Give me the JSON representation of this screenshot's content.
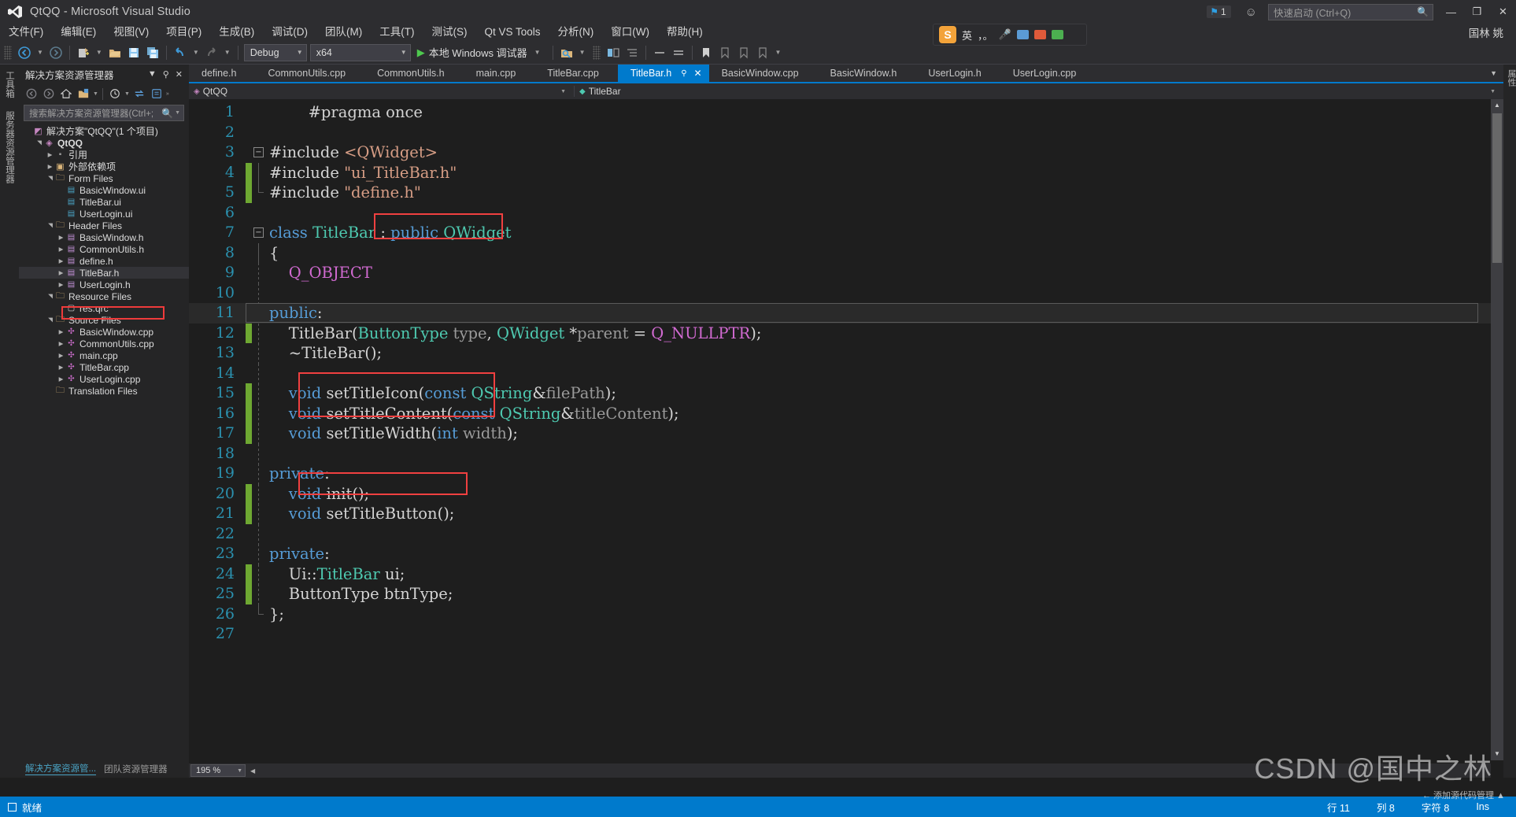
{
  "window": {
    "title": "QtQQ - Microsoft Visual Studio",
    "logo_icon": "visual-studio-logo-icon",
    "notification_count": "1",
    "notification_icon": "flag-icon",
    "feedback_icon": "feedback-smiley-icon",
    "quick_launch_placeholder": "快速启动 (Ctrl+Q)",
    "quick_launch_icon": "search-icon",
    "minimize": "—",
    "maximize": "❐",
    "close": "✕",
    "user_name": "国林 姚"
  },
  "menu": {
    "items": [
      {
        "label": "文件(F)"
      },
      {
        "label": "编辑(E)"
      },
      {
        "label": "视图(V)"
      },
      {
        "label": "项目(P)"
      },
      {
        "label": "生成(B)"
      },
      {
        "label": "调试(D)"
      },
      {
        "label": "团队(M)"
      },
      {
        "label": "工具(T)"
      },
      {
        "label": "测试(S)"
      },
      {
        "label": "Qt VS Tools"
      },
      {
        "label": "分析(N)"
      },
      {
        "label": "窗口(W)"
      },
      {
        "label": "帮助(H)"
      }
    ]
  },
  "toolbar": {
    "nav_back_icon": "arrow-back-icon",
    "nav_forward_icon": "arrow-forward-icon",
    "new_project_icon": "new-project-icon",
    "open_file_icon": "open-file-icon",
    "save_icon": "save-icon",
    "save_all_icon": "save-all-icon",
    "undo_icon": "undo-icon",
    "redo_icon": "redo-icon",
    "config": "Debug",
    "platform": "x64",
    "run_label": "本地 Windows 调试器",
    "run_icon": "play-triangle-icon",
    "find_icon": "find-in-files-icon",
    "compare_icon": "compare-icon",
    "step_icon": "step-icon",
    "indent_icon": "indent-icon",
    "comment_icon": "comment-icon",
    "uncomment_icon": "uncomment-icon",
    "bookmark_icon": "bookmark-icon"
  },
  "ime": {
    "skype_badge": "S",
    "lang": "英",
    "punct": "，。",
    "mic_icon": "microphone-icon",
    "keyboard_icon": "keyboard-icon",
    "tools_icon": "ime-tools-icon",
    "apps_icon": "ime-apps-icon"
  },
  "left_rail": {
    "tabs": [
      {
        "label": "工具箱"
      },
      {
        "label": "服务器资源管理器"
      }
    ]
  },
  "right_rail": {
    "tabs": [
      {
        "label": "属性"
      }
    ]
  },
  "solution_explorer": {
    "title": "解决方案资源管理器",
    "dropdown_icon": "chevron-down-icon",
    "pin_icon": "pin-icon",
    "close_icon": "close-icon",
    "toolbar_icons": [
      "back-icon",
      "forward-icon",
      "home-icon",
      "show-all-files-icon",
      "chevron-down-icon",
      "pending-changes-icon",
      "chevron-down-icon",
      "sync-icon",
      "refresh-icon",
      "collapse-all-icon",
      "properties-icon"
    ],
    "search_placeholder": "搜索解决方案资源管理器(Ctrl+;",
    "search_icon": "search-icon",
    "search_caret_icon": "chevron-down-icon",
    "tree": [
      {
        "label": "解决方案\"QtQQ\"(1 个项目)",
        "depth": 0,
        "expander": "",
        "icon": "solution-icon",
        "bold": false,
        "selected": false
      },
      {
        "label": "QtQQ",
        "depth": 1,
        "expander": "▲",
        "icon": "project-icon",
        "bold": true,
        "selected": false
      },
      {
        "label": "引用",
        "depth": 2,
        "expander": "▶",
        "icon": "references-icon",
        "bold": false,
        "selected": false
      },
      {
        "label": "外部依赖项",
        "depth": 2,
        "expander": "▶",
        "icon": "external-deps-icon",
        "bold": false,
        "selected": false
      },
      {
        "label": "Form Files",
        "depth": 2,
        "expander": "▲",
        "icon": "filter-folder-icon",
        "bold": false,
        "selected": false
      },
      {
        "label": "BasicWindow.ui",
        "depth": 3,
        "expander": "",
        "icon": "ui-file-icon",
        "bold": false,
        "selected": false
      },
      {
        "label": "TitleBar.ui",
        "depth": 3,
        "expander": "",
        "icon": "ui-file-icon",
        "bold": false,
        "selected": false
      },
      {
        "label": "UserLogin.ui",
        "depth": 3,
        "expander": "",
        "icon": "ui-file-icon",
        "bold": false,
        "selected": false
      },
      {
        "label": "Header Files",
        "depth": 2,
        "expander": "▲",
        "icon": "filter-folder-icon",
        "bold": false,
        "selected": false
      },
      {
        "label": "BasicWindow.h",
        "depth": 3,
        "expander": "▶",
        "icon": "header-file-icon",
        "bold": false,
        "selected": false
      },
      {
        "label": "CommonUtils.h",
        "depth": 3,
        "expander": "▶",
        "icon": "header-file-icon",
        "bold": false,
        "selected": false
      },
      {
        "label": "define.h",
        "depth": 3,
        "expander": "▶",
        "icon": "header-file-icon",
        "bold": false,
        "selected": false
      },
      {
        "label": "TitleBar.h",
        "depth": 3,
        "expander": "▶",
        "icon": "header-file-icon",
        "bold": false,
        "selected": true
      },
      {
        "label": "UserLogin.h",
        "depth": 3,
        "expander": "▶",
        "icon": "header-file-icon",
        "bold": false,
        "selected": false
      },
      {
        "label": "Resource Files",
        "depth": 2,
        "expander": "▲",
        "icon": "filter-folder-icon",
        "bold": false,
        "selected": false
      },
      {
        "label": "res.qrc",
        "depth": 3,
        "expander": "",
        "icon": "qrc-file-icon",
        "bold": false,
        "selected": false
      },
      {
        "label": "Source Files",
        "depth": 2,
        "expander": "▲",
        "icon": "filter-folder-icon",
        "bold": false,
        "selected": false
      },
      {
        "label": "BasicWindow.cpp",
        "depth": 3,
        "expander": "▶",
        "icon": "cpp-file-icon",
        "bold": false,
        "selected": false
      },
      {
        "label": "CommonUtils.cpp",
        "depth": 3,
        "expander": "▶",
        "icon": "cpp-file-icon",
        "bold": false,
        "selected": false
      },
      {
        "label": "main.cpp",
        "depth": 3,
        "expander": "▶",
        "icon": "cpp-file-icon",
        "bold": false,
        "selected": false
      },
      {
        "label": "TitleBar.cpp",
        "depth": 3,
        "expander": "▶",
        "icon": "cpp-file-icon",
        "bold": false,
        "selected": false
      },
      {
        "label": "UserLogin.cpp",
        "depth": 3,
        "expander": "▶",
        "icon": "cpp-file-icon",
        "bold": false,
        "selected": false
      },
      {
        "label": "Translation Files",
        "depth": 2,
        "expander": "",
        "icon": "filter-folder-icon",
        "bold": false,
        "selected": false
      }
    ],
    "bottom_tabs": [
      {
        "label": "解决方案资源管...",
        "active": true
      },
      {
        "label": "团队资源管理器",
        "active": false
      }
    ]
  },
  "editor": {
    "tabs": [
      {
        "label": "define.h",
        "active": false
      },
      {
        "label": "CommonUtils.cpp",
        "active": false
      },
      {
        "label": "CommonUtils.h",
        "active": false
      },
      {
        "label": "main.cpp",
        "active": false
      },
      {
        "label": "TitleBar.cpp",
        "active": false
      },
      {
        "label": "TitleBar.h",
        "active": true
      },
      {
        "label": "BasicWindow.cpp",
        "active": false
      },
      {
        "label": "BasicWindow.h",
        "active": false
      },
      {
        "label": "UserLogin.h",
        "active": false
      },
      {
        "label": "UserLogin.cpp",
        "active": false
      }
    ],
    "active_tab_pin_icon": "pin-icon",
    "active_tab_close_icon": "close-icon",
    "tab_overflow_icon": "chevron-down-icon",
    "nav_project": "QtQQ",
    "nav_project_icon": "project-icon",
    "nav_member": "TitleBar",
    "nav_member_icon": "class-icon",
    "nav_caret_icon": "chevron-down-icon",
    "zoom": "195 %",
    "zoom_caret_icon": "chevron-down-icon",
    "lines": [
      {
        "n": "1",
        "changed": false,
        "indent": 0,
        "tokens": [
          {
            "t": "        ",
            "c": "pl"
          },
          {
            "t": "#pragma once",
            "c": "pl"
          }
        ]
      },
      {
        "n": "2",
        "changed": false,
        "indent": 0,
        "tokens": []
      },
      {
        "n": "3",
        "changed": false,
        "indent": 0,
        "fold": "minus",
        "tokens": [
          {
            "t": "#include ",
            "c": "pl"
          },
          {
            "t": "<QWidget>",
            "c": "s"
          }
        ]
      },
      {
        "n": "4",
        "changed": true,
        "indent": 0,
        "bar": "line",
        "tokens": [
          {
            "t": "#include ",
            "c": "pl"
          },
          {
            "t": "\"ui_TitleBar.h\"",
            "c": "s"
          }
        ]
      },
      {
        "n": "5",
        "changed": true,
        "indent": 0,
        "bar": "corner",
        "tokens": [
          {
            "t": "#include ",
            "c": "pl"
          },
          {
            "t": "\"define.h\"",
            "c": "s"
          }
        ]
      },
      {
        "n": "6",
        "changed": false,
        "indent": 0,
        "tokens": []
      },
      {
        "n": "7",
        "changed": false,
        "indent": 0,
        "fold": "minus",
        "tokens": [
          {
            "t": "class ",
            "c": "k"
          },
          {
            "t": "TitleBar",
            "c": "t"
          },
          {
            "t": " : ",
            "c": "pl"
          },
          {
            "t": "public ",
            "c": "k"
          },
          {
            "t": "QWidget",
            "c": "t"
          }
        ]
      },
      {
        "n": "8",
        "changed": false,
        "indent": 0,
        "bar": "line",
        "tokens": [
          {
            "t": "{",
            "c": "pl"
          }
        ]
      },
      {
        "n": "9",
        "changed": false,
        "indent": 0,
        "bar": "dash",
        "tokens": [
          {
            "t": "    ",
            "c": "pl"
          },
          {
            "t": "Q_OBJECT",
            "c": "m"
          }
        ]
      },
      {
        "n": "10",
        "changed": false,
        "indent": 0,
        "bar": "dash",
        "tokens": []
      },
      {
        "n": "11",
        "changed": false,
        "indent": 0,
        "highlight": true,
        "tokens": [
          {
            "t": "public",
            "c": "k"
          },
          {
            "t": ":",
            "c": "pl"
          }
        ]
      },
      {
        "n": "12",
        "changed": true,
        "indent": 0,
        "bar": "dash",
        "tokens": [
          {
            "t": "    ",
            "c": "pl"
          },
          {
            "t": "TitleBar",
            "c": "pl"
          },
          {
            "t": "(",
            "c": "pl"
          },
          {
            "t": "ButtonType",
            "c": "t"
          },
          {
            "t": " ",
            "c": "pl"
          },
          {
            "t": "type",
            "c": "pa"
          },
          {
            "t": ", ",
            "c": "pl"
          },
          {
            "t": "QWidget",
            "c": "t"
          },
          {
            "t": " *",
            "c": "pl"
          },
          {
            "t": "parent",
            "c": "pa"
          },
          {
            "t": " = ",
            "c": "pl"
          },
          {
            "t": "Q_NULLPTR",
            "c": "m"
          },
          {
            "t": ");",
            "c": "pl"
          }
        ]
      },
      {
        "n": "13",
        "changed": false,
        "indent": 0,
        "bar": "dash",
        "tokens": [
          {
            "t": "    ~TitleBar();",
            "c": "pl"
          }
        ]
      },
      {
        "n": "14",
        "changed": false,
        "indent": 0,
        "bar": "dash",
        "tokens": []
      },
      {
        "n": "15",
        "changed": true,
        "indent": 0,
        "bar": "dash",
        "tokens": [
          {
            "t": "    ",
            "c": "pl"
          },
          {
            "t": "void ",
            "c": "k"
          },
          {
            "t": "setTitleIcon",
            "c": "pl"
          },
          {
            "t": "(",
            "c": "pl"
          },
          {
            "t": "const ",
            "c": "k"
          },
          {
            "t": "QString",
            "c": "t"
          },
          {
            "t": "&",
            "c": "pl"
          },
          {
            "t": "filePath",
            "c": "pa"
          },
          {
            "t": ");",
            "c": "pl"
          }
        ]
      },
      {
        "n": "16",
        "changed": true,
        "indent": 0,
        "bar": "dash",
        "tokens": [
          {
            "t": "    ",
            "c": "pl"
          },
          {
            "t": "void ",
            "c": "k"
          },
          {
            "t": "setTitleContent",
            "c": "pl"
          },
          {
            "t": "(",
            "c": "pl"
          },
          {
            "t": "const ",
            "c": "k"
          },
          {
            "t": "QString",
            "c": "t"
          },
          {
            "t": "&",
            "c": "pl"
          },
          {
            "t": "titleContent",
            "c": "pa"
          },
          {
            "t": ");",
            "c": "pl"
          }
        ]
      },
      {
        "n": "17",
        "changed": true,
        "indent": 0,
        "bar": "dash",
        "tokens": [
          {
            "t": "    ",
            "c": "pl"
          },
          {
            "t": "void ",
            "c": "k"
          },
          {
            "t": "setTitleWidth",
            "c": "pl"
          },
          {
            "t": "(",
            "c": "pl"
          },
          {
            "t": "int ",
            "c": "k"
          },
          {
            "t": "width",
            "c": "pa"
          },
          {
            "t": ");",
            "c": "pl"
          }
        ]
      },
      {
        "n": "18",
        "changed": false,
        "indent": 0,
        "bar": "dash",
        "tokens": []
      },
      {
        "n": "19",
        "changed": false,
        "indent": 0,
        "bar": "dash",
        "tokens": [
          {
            "t": "private",
            "c": "k"
          },
          {
            "t": ":",
            "c": "pl"
          }
        ]
      },
      {
        "n": "20",
        "changed": true,
        "indent": 0,
        "bar": "dash",
        "tokens": [
          {
            "t": "    ",
            "c": "pl"
          },
          {
            "t": "void ",
            "c": "k"
          },
          {
            "t": "init",
            "c": "pl"
          },
          {
            "t": "();",
            "c": "pl"
          }
        ]
      },
      {
        "n": "21",
        "changed": true,
        "indent": 0,
        "bar": "dash",
        "tokens": [
          {
            "t": "    ",
            "c": "pl"
          },
          {
            "t": "void ",
            "c": "k"
          },
          {
            "t": "setTitleButton",
            "c": "pl"
          },
          {
            "t": "();",
            "c": "pl"
          }
        ]
      },
      {
        "n": "22",
        "changed": false,
        "indent": 0,
        "bar": "dash",
        "tokens": []
      },
      {
        "n": "23",
        "changed": false,
        "indent": 0,
        "bar": "dash",
        "tokens": [
          {
            "t": "private",
            "c": "k"
          },
          {
            "t": ":",
            "c": "pl"
          }
        ]
      },
      {
        "n": "24",
        "changed": true,
        "indent": 0,
        "bar": "dash",
        "tokens": [
          {
            "t": "    ",
            "c": "pl"
          },
          {
            "t": "Ui::",
            "c": "pl"
          },
          {
            "t": "TitleBar",
            "c": "t"
          },
          {
            "t": " ",
            "c": "pl"
          },
          {
            "t": "ui",
            "c": "pl"
          },
          {
            "t": ";",
            "c": "pl"
          }
        ]
      },
      {
        "n": "25",
        "changed": true,
        "indent": 0,
        "bar": "dash",
        "tokens": [
          {
            "t": "    ",
            "c": "pl"
          },
          {
            "t": "ButtonType",
            "c": "pl"
          },
          {
            "t": " ",
            "c": "pl"
          },
          {
            "t": "btnType",
            "c": "pl"
          },
          {
            "t": ";",
            "c": "pl"
          }
        ]
      },
      {
        "n": "26",
        "changed": false,
        "indent": 0,
        "bar": "end",
        "tokens": [
          {
            "t": "};",
            "c": "pl"
          }
        ]
      },
      {
        "n": "27",
        "changed": false,
        "indent": 0,
        "tokens": []
      }
    ],
    "annotations": [
      {
        "name": "buttontype-type-highlight"
      },
      {
        "name": "init-settitlebutton-highlight"
      },
      {
        "name": "buttontype-btntype-highlight"
      }
    ]
  },
  "statusbar": {
    "ready": "就绪",
    "ready_icon": "status-box-icon",
    "line_label": "行 11",
    "col_label": "列 8",
    "char_label": "字符 8",
    "ins_label": "Ins"
  },
  "watermarks": {
    "main": "CSDN @国中之林",
    "sub": "← 添加源代码管理 ▲"
  },
  "colors": {
    "accent": "#007acc",
    "chrome": "#2d2d30",
    "panel": "#252526",
    "editor_bg": "#1e1e1e",
    "highlight_red": "#f04040",
    "changed_green": "#6ea832"
  }
}
